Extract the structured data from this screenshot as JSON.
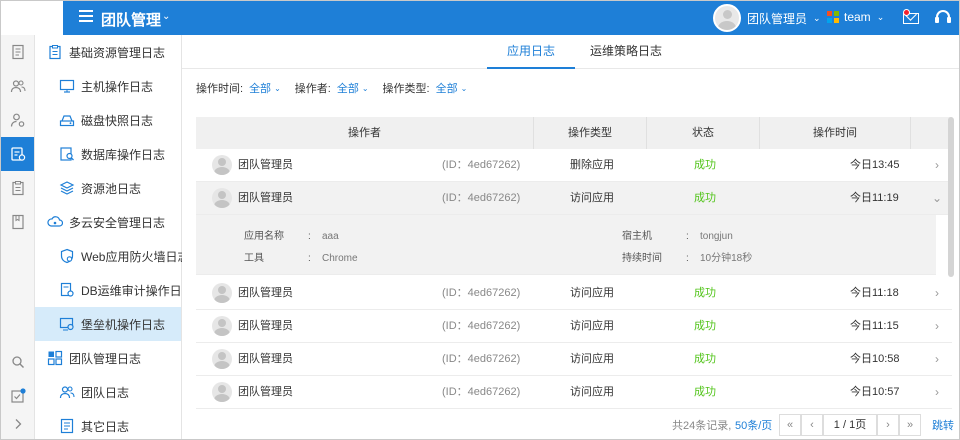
{
  "header": {
    "app_title": "团队管理",
    "user_name": "团队管理员",
    "team_name": "team"
  },
  "colors": {
    "primary": "#1e7fd7",
    "success": "#52c41a",
    "notification_dot": "#f5222d",
    "selected_nav_bg": "#d6ebfa",
    "team_logo": [
      "#f25022",
      "#7fba00",
      "#00a4ef",
      "#ffb900"
    ]
  },
  "rail_icons": [
    "document-icon",
    "users-icon",
    "user-settings-icon",
    "log-icon",
    "clipboard-icon",
    "book-icon",
    "search-icon",
    "checklist-icon",
    "chevron-right-icon"
  ],
  "sidebar": {
    "groups": [
      {
        "label": "基础资源管理日志",
        "items": [
          "主机操作日志",
          "磁盘快照日志",
          "数据库操作日志",
          "资源池日志"
        ]
      },
      {
        "label": "多云安全管理日志",
        "items": [
          "Web应用防火墙日志",
          "DB运维审计操作日志",
          "堡垒机操作日志"
        ]
      },
      {
        "label": "团队管理日志",
        "items": [
          "团队日志",
          "其它日志"
        ]
      }
    ],
    "active_item": "堡垒机操作日志"
  },
  "tabs": [
    "应用日志",
    "运维策略日志"
  ],
  "filters": [
    {
      "label": "操作时间:",
      "value": "全部"
    },
    {
      "label": "操作者:",
      "value": "全部"
    },
    {
      "label": "操作类型:",
      "value": "全部"
    }
  ],
  "table": {
    "columns": [
      "操作者",
      "操作类型",
      "状态",
      "操作时间"
    ],
    "rows": [
      {
        "operator": "团队管理员",
        "id": "(ID：4ed67262)",
        "type": "删除应用",
        "status": "成功",
        "time": "今日13:45"
      },
      {
        "operator": "团队管理员",
        "id": "(ID：4ed67262)",
        "type": "访问应用",
        "status": "成功",
        "time": "今日11:19"
      },
      {
        "operator": "团队管理员",
        "id": "(ID：4ed67262)",
        "type": "访问应用",
        "status": "成功",
        "time": "今日11:18"
      },
      {
        "operator": "团队管理员",
        "id": "(ID：4ed67262)",
        "type": "访问应用",
        "status": "成功",
        "time": "今日11:15"
      },
      {
        "operator": "团队管理员",
        "id": "(ID：4ed67262)",
        "type": "访问应用",
        "status": "成功",
        "time": "今日10:58"
      },
      {
        "operator": "团队管理员",
        "id": "(ID：4ed67262)",
        "type": "访问应用",
        "status": "成功",
        "time": "今日10:57"
      }
    ],
    "detail": {
      "app_name_label": "应用名称",
      "app_name_value": "aaa",
      "tool_label": "工具",
      "tool_value": "Chrome",
      "host_label": "宿主机",
      "host_value": "tongjun",
      "duration_label": "持续时间",
      "duration_value": "10分钟18秒",
      "separator": ":"
    }
  },
  "pagination": {
    "total": "共24条记录,",
    "page_size": "50条/页",
    "page_indicator": "1 / 1页",
    "jump": "跳转"
  }
}
